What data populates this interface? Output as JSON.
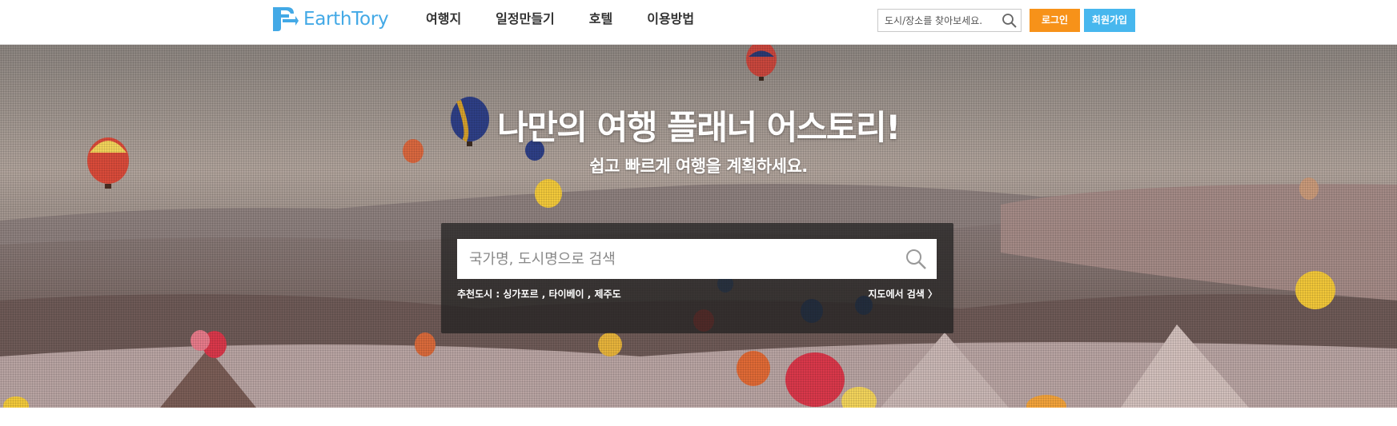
{
  "header": {
    "logo_text": "EarthTory",
    "nav": [
      {
        "label": "여행지"
      },
      {
        "label": "일정만들기"
      },
      {
        "label": "호텔"
      },
      {
        "label": "이용방법"
      }
    ],
    "search_placeholder": "도시/장소를 찾아보세요.",
    "login_label": "로그인",
    "signup_label": "회원가입"
  },
  "hero": {
    "title": "나만의 여행 플래너 어스토리!",
    "subtitle": "쉽고 빠르게 여행을 계획하세요.",
    "search_placeholder": "국가명, 도시명으로 검색",
    "recommend_label": "추천도시 :",
    "recommend_cities": [
      "싱가포르",
      "타이베이",
      "제주도"
    ],
    "separator": ",",
    "map_search_label": "지도에서 검색 〉"
  },
  "colors": {
    "brand": "#43a9e6",
    "login": "#f79219",
    "signup": "#47b7ee"
  }
}
